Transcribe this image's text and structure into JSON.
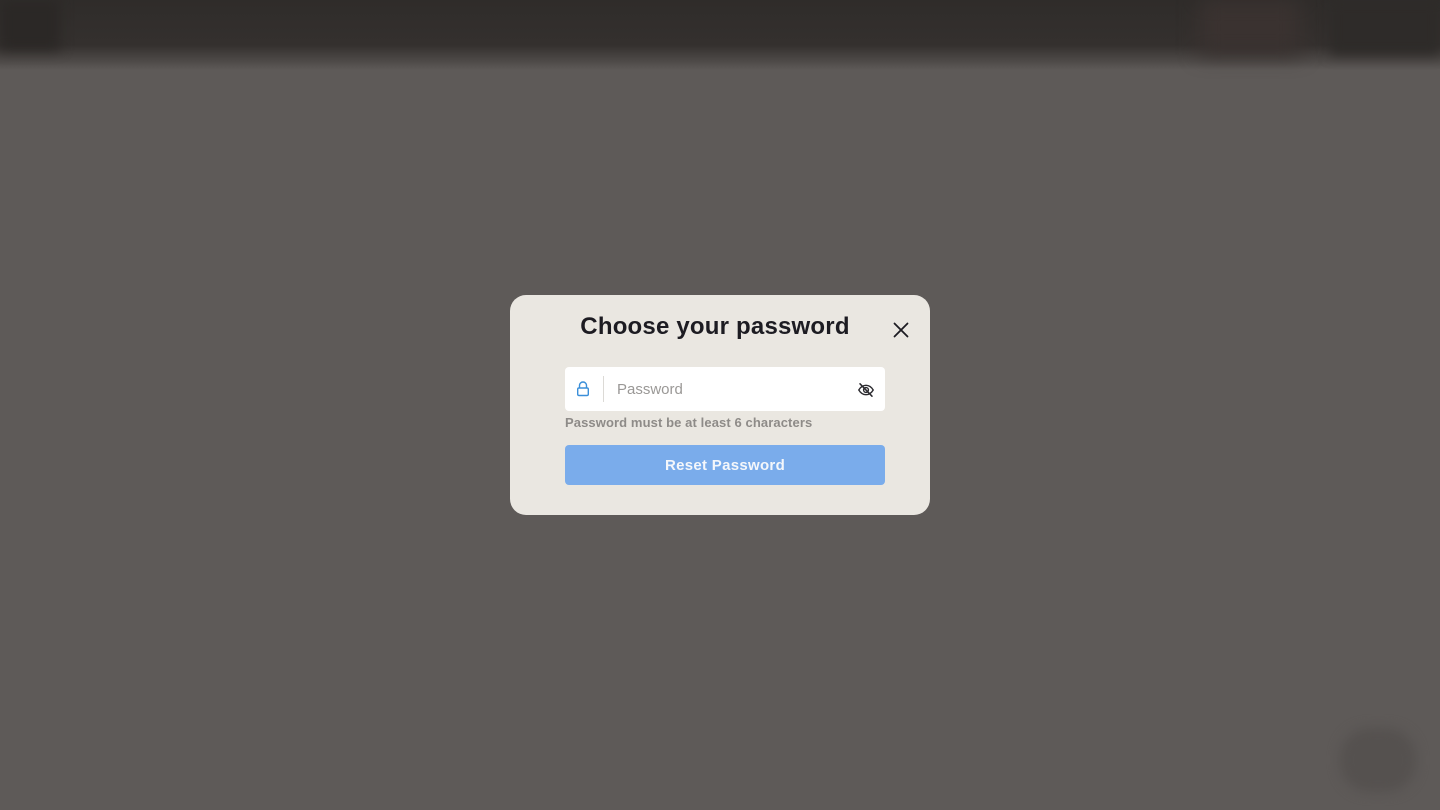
{
  "modal": {
    "title": "Choose your password",
    "close_icon": "close-icon",
    "password_field": {
      "placeholder": "Password",
      "value": "",
      "lock_icon": "lock-icon",
      "visibility_icon": "eye-off-icon"
    },
    "hint": "Password must be at least 6 characters",
    "submit_label": "Reset Password"
  },
  "colors": {
    "overlay": "#5e5a58",
    "modal_bg": "#eae7e1",
    "button_disabled": "#7aaceb",
    "icon_accent": "#3b8fd9",
    "title_text": "#1d1c22"
  }
}
